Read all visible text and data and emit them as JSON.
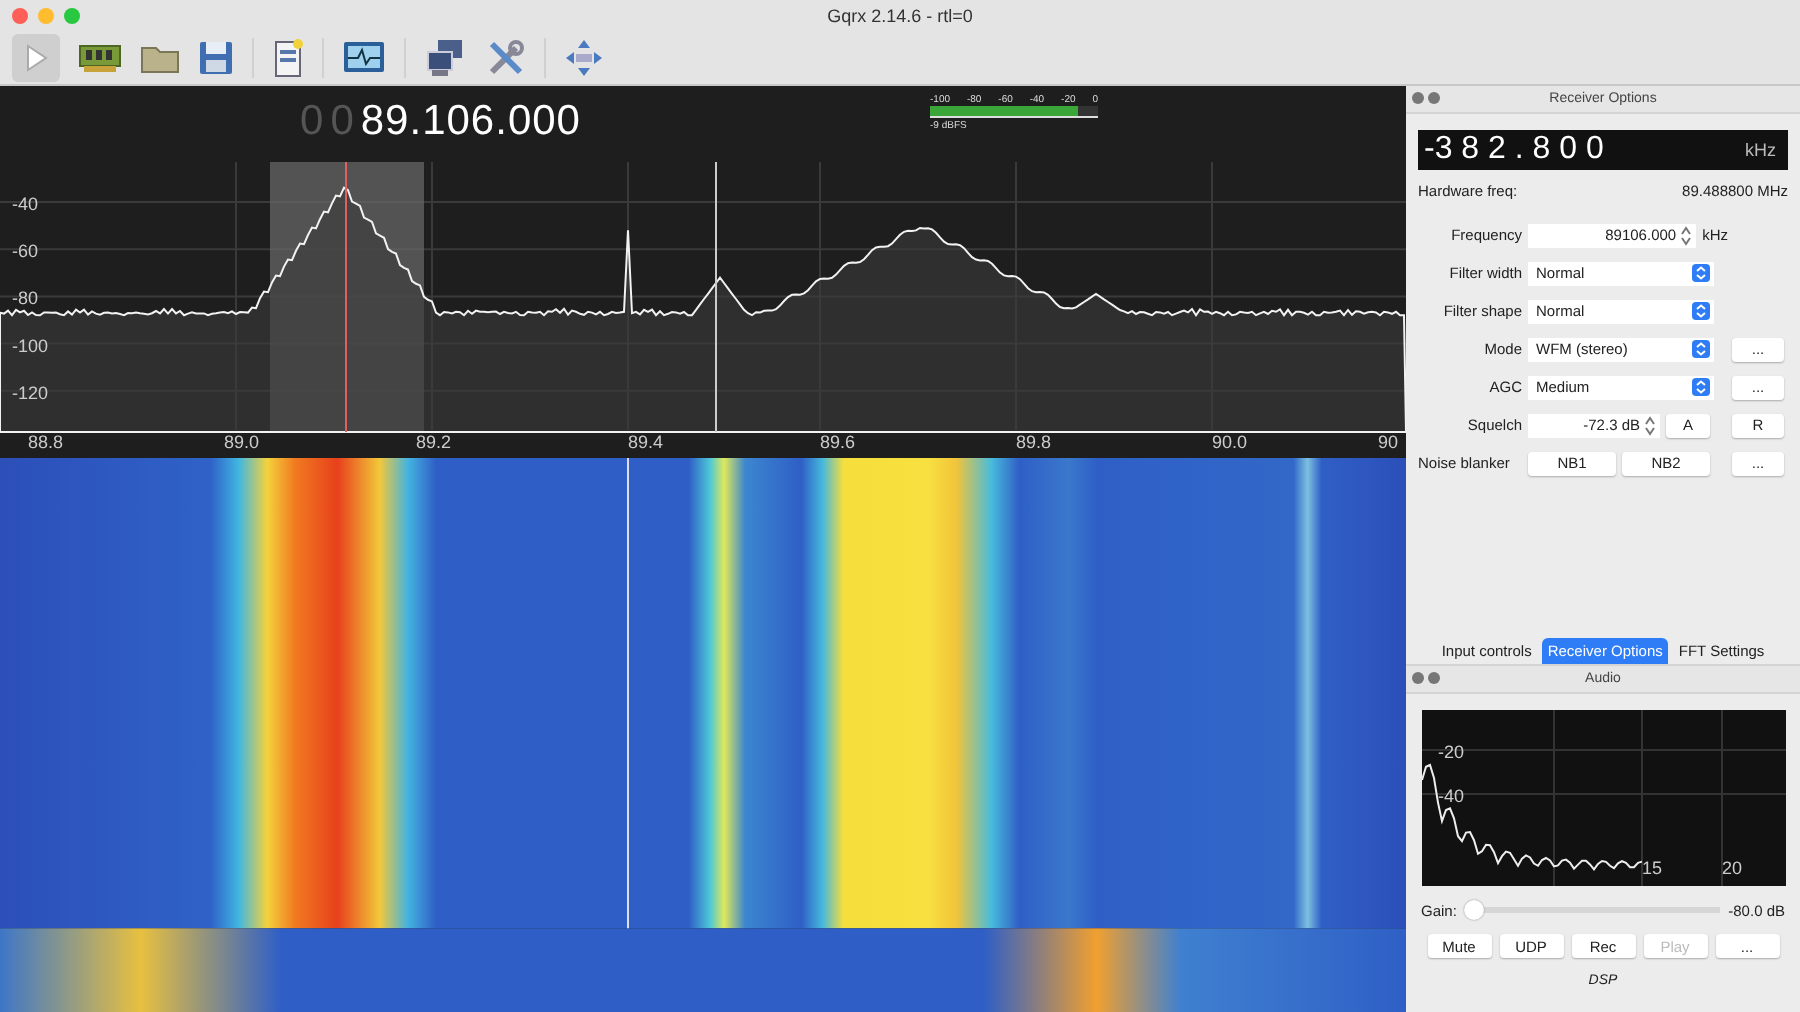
{
  "window": {
    "title": "Gqrx 2.14.6 - rtl=0"
  },
  "frequency_display": {
    "inactive_digits": [
      "0",
      "0"
    ],
    "value": "89.106.000"
  },
  "signal_meter": {
    "ticks": [
      "-100",
      "-80",
      "-60",
      "-40",
      "-20",
      "0"
    ],
    "level": 0.88,
    "reading": "-9 dBFS"
  },
  "spectrum": {
    "y_ticks": [
      "-40",
      "-60",
      "-80",
      "-100",
      "-120"
    ],
    "x_ticks": [
      "88.8",
      "89.0",
      "89.2",
      "89.4",
      "89.6",
      "89.8",
      "90.0",
      "90"
    ]
  },
  "receiver_options": {
    "title": "Receiver Options",
    "offset_display": {
      "value": "-3 8 2 . 8 0 0",
      "unit": "kHz"
    },
    "hardware_freq": {
      "label": "Hardware freq:",
      "value": "89.488800 MHz"
    },
    "rows": [
      {
        "label": "Frequency",
        "kind": "spin",
        "value": "89106.000",
        "unit": "kHz",
        "buttons": []
      },
      {
        "label": "Filter width",
        "kind": "select",
        "value": "Normal",
        "buttons": []
      },
      {
        "label": "Filter shape",
        "kind": "select",
        "value": "Normal",
        "buttons": []
      },
      {
        "label": "Mode",
        "kind": "select",
        "value": "WFM (stereo)",
        "buttons": [
          "..."
        ]
      },
      {
        "label": "AGC",
        "kind": "select",
        "value": "Medium",
        "buttons": [
          "..."
        ]
      },
      {
        "label": "Squelch",
        "kind": "spin",
        "value": "-72.3 dB",
        "side_button": "A",
        "buttons": [
          "R"
        ]
      },
      {
        "label": "Noise blanker",
        "kind": "buttons",
        "value_buttons": [
          "NB1",
          "NB2"
        ],
        "buttons": [
          "..."
        ]
      }
    ]
  },
  "tabs": [
    {
      "label": "Input controls",
      "selected": false
    },
    {
      "label": "Receiver Options",
      "selected": true
    },
    {
      "label": "FFT Settings",
      "selected": false
    }
  ],
  "audio": {
    "title": "Audio",
    "y_ticks": [
      "-20",
      "-40"
    ],
    "x_ticks": [
      "15",
      "20"
    ],
    "gain": {
      "label": "Gain:",
      "level": 0,
      "reading": "-80.0 dB"
    },
    "buttons": [
      {
        "label": "Mute",
        "disabled": false
      },
      {
        "label": "UDP",
        "disabled": false
      },
      {
        "label": "Rec",
        "disabled": false
      },
      {
        "label": "Play",
        "disabled": true
      },
      {
        "label": "...",
        "disabled": false
      }
    ],
    "footer": "DSP"
  }
}
